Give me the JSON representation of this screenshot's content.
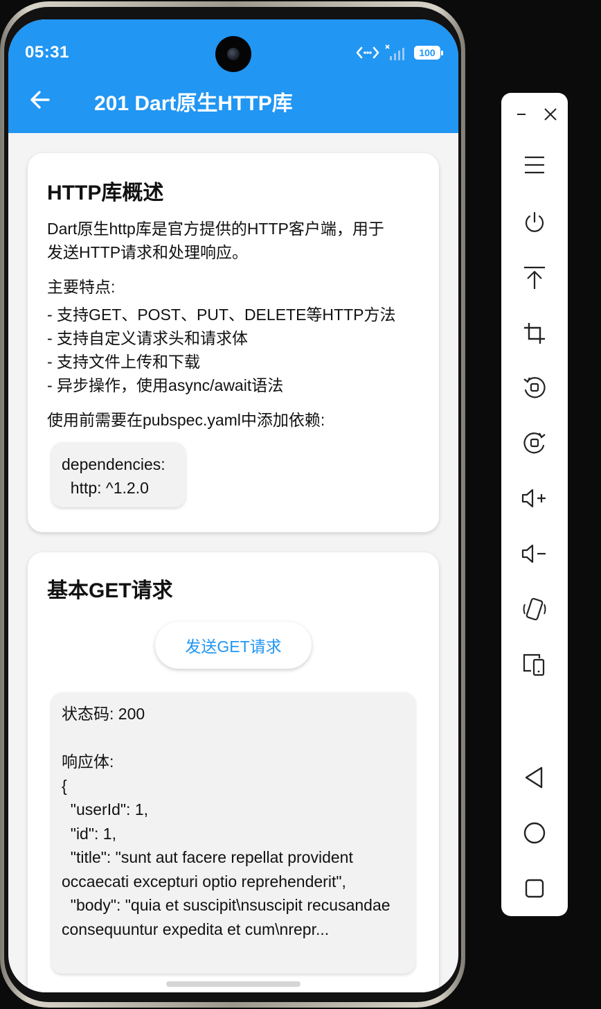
{
  "status_bar": {
    "time": "05:31",
    "battery": "100"
  },
  "app_bar": {
    "title": "201 Dart原生HTTP库"
  },
  "overview_card": {
    "title": "HTTP库概述",
    "intro": "Dart原生http库是官方提供的HTTP客户端，用于\n发送HTTP请求和处理响应。",
    "features_heading": "主要特点:",
    "features": "- 支持GET、POST、PUT、DELETE等HTTP方法\n- 支持自定义请求头和请求体\n- 支持文件上传和下载\n- 异步操作，使用async/await语法",
    "dependency_note": "使用前需要在pubspec.yaml中添加依赖:",
    "dependency_code": "dependencies:\n  http: ^1.2.0"
  },
  "get_card": {
    "title": "基本GET请求",
    "button_label": "发送GET请求",
    "response": "状态码: 200\n\n响应体:\n{\n  \"userId\": 1,\n  \"id\": 1,\n  \"title\": \"sunt aut facere repellat provident occaecati excepturi optio reprehenderit\",\n  \"body\": \"quia et suscipit\\nsuscipit recusandae consequuntur expedita et cum\\nrepr..."
  },
  "toolbar": {
    "icons": [
      "minimize-icon",
      "close-icon",
      "menu-icon",
      "power-icon",
      "screenshot-top-icon",
      "crop-icon",
      "rotate-left-icon",
      "rotate-right-icon",
      "volume-up-icon",
      "volume-down-icon",
      "shake-icon",
      "device-switch-icon",
      "back-nav-icon",
      "home-nav-icon",
      "recents-nav-icon"
    ]
  }
}
